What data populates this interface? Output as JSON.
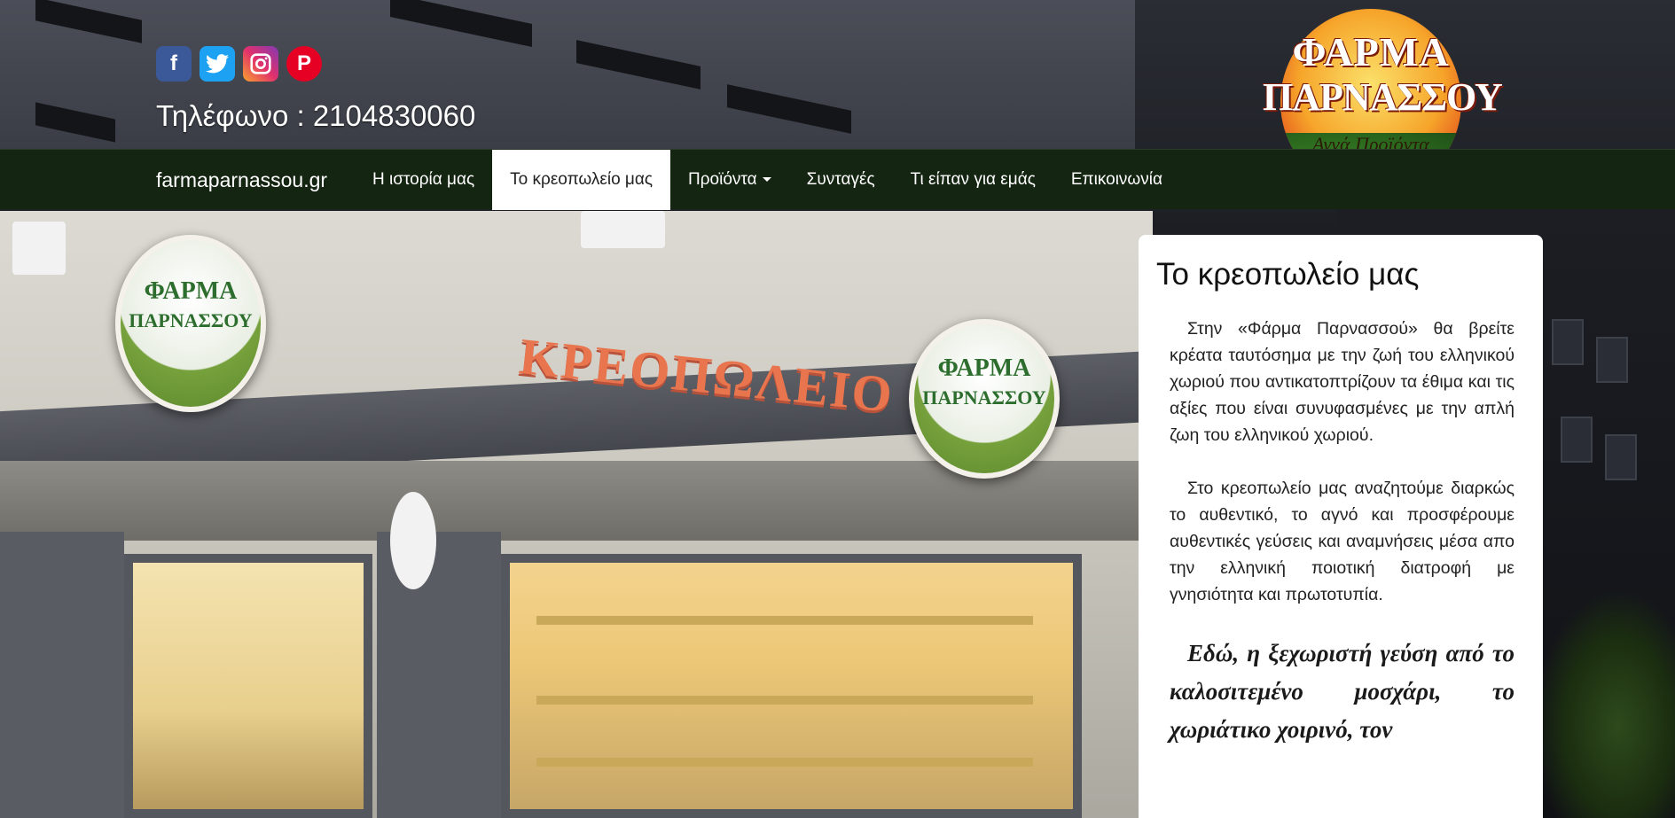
{
  "header": {
    "social": [
      {
        "name": "facebook-icon",
        "glyph": "f"
      },
      {
        "name": "twitter-icon",
        "glyph": "🐦"
      },
      {
        "name": "instagram-icon",
        "glyph": "◎"
      },
      {
        "name": "pinterest-icon",
        "glyph": "P"
      }
    ],
    "phone": "Τηλέφωνο : 2104830060",
    "logo": {
      "line1": "ΦΑΡΜΑ",
      "line2": "ΠΑΡΝΑΣΣΟΥ",
      "tagline": "Αγνά Προϊόντα"
    }
  },
  "nav": {
    "brand": "farmaparnassou.gr",
    "items": [
      {
        "label": "Η ιστορία μας"
      },
      {
        "label": "Το κρεοπωλείο μας"
      },
      {
        "label": "Προϊόντα"
      },
      {
        "label": "Συνταγές"
      },
      {
        "label": "Τι είπαν για εμάς"
      },
      {
        "label": "Επικοινωνία"
      }
    ]
  },
  "panel": {
    "title": "Το κρεοπωλείο μας",
    "p1": "Στην «Φάρμα Παρνασσού» θα βρείτε κρέατα ταυτόσημα με την ζωή του ελληνικού χωριού που αντικατοπτρίζουν τα έθιμα και τις αξίες που είναι συνυφασμένες με την απλή ζωη του ελληνικού χωριού.",
    "p2": "Στο κρεοπωλείο μας αναζητούμε διαρκώς το αυθεντικό, το αγνό και προσφέρουμε αυθεντικές γεύσεις και αναμνήσεις μέσα απο την ελληνική ποιοτική διατροφή με γνησιότητα και πρωτοτυπία.",
    "p3": "Εδώ, η ξεχωριστή γεύση από το καλοσιτεμένο μοσχάρι, το χωριάτικο χοιρινό, τον"
  },
  "photo": {
    "sign_text": "ΚΡΕΟΠΩΛΕΙΟ",
    "badge_line1": "ΦΑΡΜΑ",
    "badge_line2": "ΠΑΡΝΑΣΣΟΥ"
  },
  "colors": {
    "nav_bg": "#142512",
    "active_tab_bg": "#ffffff",
    "panel_bg": "#ffffff"
  }
}
